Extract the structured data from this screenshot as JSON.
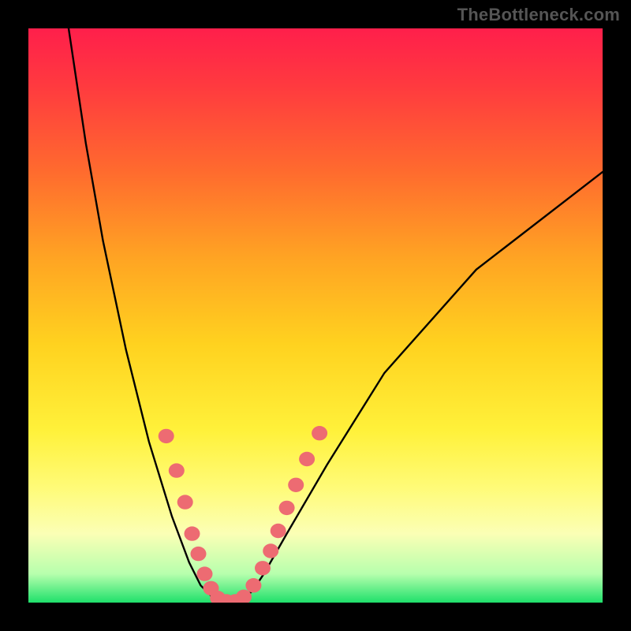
{
  "watermark": "TheBottleneck.com",
  "colors": {
    "gradient_top": "#ff1f4b",
    "gradient_bottom": "#1fe06b",
    "curve_stroke": "#000000",
    "marker_fill": "#ed6b72",
    "frame": "#000000"
  },
  "chart_data": {
    "type": "line",
    "title": "",
    "xlabel": "",
    "ylabel": "",
    "xlim": [
      0,
      100
    ],
    "ylim": [
      0,
      100
    ],
    "series": [
      {
        "name": "left-curve",
        "x": [
          7,
          10,
          13,
          17,
          21,
          25,
          28,
          30,
          32,
          33,
          34
        ],
        "y": [
          100,
          80,
          63,
          44,
          28,
          15,
          7,
          3,
          1,
          0.4,
          0
        ]
      },
      {
        "name": "right-curve",
        "x": [
          36,
          37,
          39,
          41,
          45,
          52,
          62,
          78,
          100
        ],
        "y": [
          0,
          0.4,
          2,
          5,
          12,
          24,
          40,
          58,
          75
        ]
      }
    ],
    "markers": [
      {
        "series": "left-curve",
        "x": 24.0,
        "y": 29.0
      },
      {
        "series": "left-curve",
        "x": 25.8,
        "y": 23.0
      },
      {
        "series": "left-curve",
        "x": 27.3,
        "y": 17.5
      },
      {
        "series": "left-curve",
        "x": 28.5,
        "y": 12.0
      },
      {
        "series": "left-curve",
        "x": 29.6,
        "y": 8.5
      },
      {
        "series": "left-curve",
        "x": 30.7,
        "y": 5.0
      },
      {
        "series": "left-curve",
        "x": 31.8,
        "y": 2.5
      },
      {
        "series": "left-curve",
        "x": 33.0,
        "y": 0.8
      },
      {
        "series": "left-curve",
        "x": 34.5,
        "y": 0.2
      },
      {
        "series": "right-curve",
        "x": 36.0,
        "y": 0.2
      },
      {
        "series": "right-curve",
        "x": 37.5,
        "y": 1.0
      },
      {
        "series": "right-curve",
        "x": 39.2,
        "y": 3.0
      },
      {
        "series": "right-curve",
        "x": 40.8,
        "y": 6.0
      },
      {
        "series": "right-curve",
        "x": 42.2,
        "y": 9.0
      },
      {
        "series": "right-curve",
        "x": 43.5,
        "y": 12.5
      },
      {
        "series": "right-curve",
        "x": 45.0,
        "y": 16.5
      },
      {
        "series": "right-curve",
        "x": 46.6,
        "y": 20.5
      },
      {
        "series": "right-curve",
        "x": 48.5,
        "y": 25.0
      },
      {
        "series": "right-curve",
        "x": 50.7,
        "y": 29.5
      }
    ]
  }
}
